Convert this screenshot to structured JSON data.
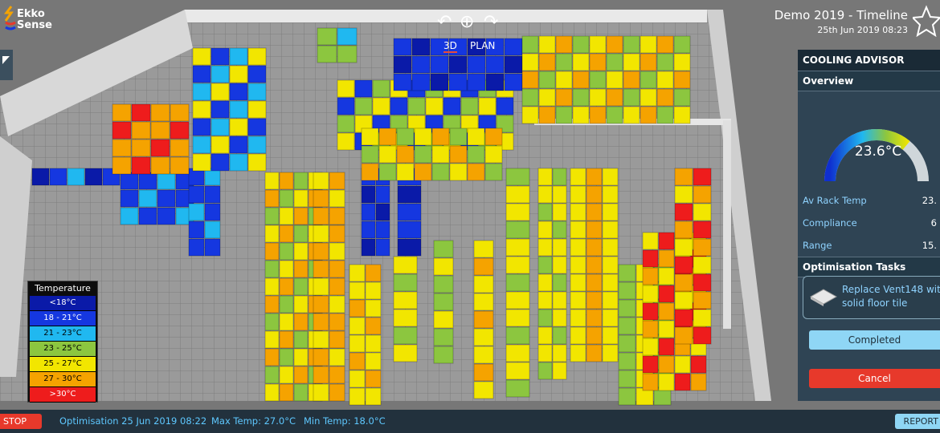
{
  "app": {
    "logo_line1": "Ekko",
    "logo_line2": "Sense"
  },
  "header": {
    "title": "Demo 2019 - Timeline",
    "datetime": "25th Jun 2019 08:23",
    "view_tabs": [
      "3D",
      "PLAN"
    ],
    "active_view": "3D"
  },
  "legend": {
    "title": "Temperature",
    "items": [
      {
        "label": "<18°C",
        "color": "#0a1aa8",
        "text_color": "#ffffff"
      },
      {
        "label": "18 - 21°C",
        "color": "#1537e0",
        "text_color": "#ffffff"
      },
      {
        "label": "21 - 23°C",
        "color": "#20b8f0",
        "text_color": "#000000"
      },
      {
        "label": "23 - 25°C",
        "color": "#8cc63f",
        "text_color": "#000000"
      },
      {
        "label": "25 - 27°C",
        "color": "#f2e600",
        "text_color": "#000000"
      },
      {
        "label": "27 - 30°C",
        "color": "#f5a300",
        "text_color": "#000000"
      },
      {
        "label": ">30°C",
        "color": "#ee1c1c",
        "text_color": "#ffffff"
      }
    ]
  },
  "panel": {
    "title": "COOLING ADVISOR",
    "overview_label": "Overview",
    "gauge_value": "23.6°C",
    "gauge_fraction": 0.72,
    "metrics": [
      {
        "label": "Av Rack Temp",
        "value": "23."
      },
      {
        "label": "Compliance",
        "value": "6"
      },
      {
        "label": "Range",
        "value": "15."
      }
    ],
    "tasks_label": "Optimisation Tasks",
    "task": {
      "line1": "Replace Vent148 with",
      "line2": "solid floor tile"
    },
    "completed_label": "Completed",
    "cancel_label": "Cancel"
  },
  "status_bar": {
    "stop_label": "STOP",
    "optimisation": "Optimisation 25 Jun 2019 08:22",
    "max_temp": "Max Temp: 27.0°C",
    "min_temp": "Min Temp: 18.0°C",
    "report_label": "REPORT"
  },
  "colors": {
    "accent": "#5ec8ff",
    "stop": "#e7392b",
    "panel_bg": "#2f4454"
  }
}
